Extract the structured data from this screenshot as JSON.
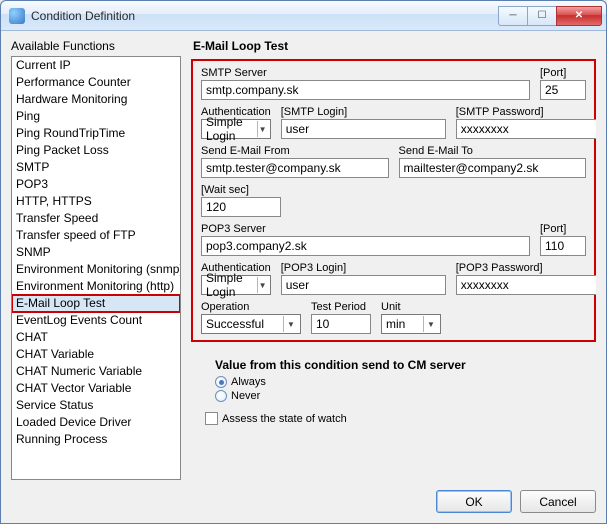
{
  "window": {
    "title": "Condition Definition"
  },
  "left": {
    "label": "Available Functions",
    "items": [
      "Current IP",
      "Performance Counter",
      "Hardware Monitoring",
      "Ping",
      "Ping RoundTripTime",
      "Ping Packet Loss",
      "SMTP",
      "POP3",
      "HTTP, HTTPS",
      "Transfer Speed",
      "Transfer speed of FTP",
      "SNMP",
      "Environment Monitoring (snmp)",
      "Environment Monitoring (http)",
      "E-Mail Loop Test",
      "EventLog Events Count",
      "CHAT",
      "CHAT Variable",
      "CHAT Numeric Variable",
      "CHAT Vector Variable",
      "Service Status",
      "Loaded Device Driver",
      "Running Process"
    ],
    "selected_index": 14,
    "redbox_index": 14
  },
  "form": {
    "title": "E-Mail Loop Test",
    "smtp_server": {
      "label": "SMTP Server",
      "value": "smtp.company.sk"
    },
    "smtp_port": {
      "label": "[Port]",
      "value": "25"
    },
    "smtp_auth": {
      "label": "Authentication",
      "value": "Simple Login"
    },
    "smtp_login": {
      "label": "[SMTP Login]",
      "value": "user"
    },
    "smtp_password": {
      "label": "[SMTP Password]",
      "value": "xxxxxxxx"
    },
    "send_from": {
      "label": "Send E-Mail From",
      "value": "smtp.tester@company.sk"
    },
    "send_to": {
      "label": "Send E-Mail To",
      "value": "mailtester@company2.sk"
    },
    "wait_sec": {
      "label": "[Wait sec]",
      "value": "120"
    },
    "pop3_server": {
      "label": "POP3 Server",
      "value": "pop3.company2.sk"
    },
    "pop3_port": {
      "label": "[Port]",
      "value": "110"
    },
    "pop3_auth": {
      "label": "Authentication",
      "value": "Simple Login"
    },
    "pop3_login": {
      "label": "[POP3 Login]",
      "value": "user"
    },
    "pop3_password": {
      "label": "[POP3 Password]",
      "value": "xxxxxxxx"
    },
    "operation": {
      "label": "Operation",
      "value": "Successful"
    },
    "test_period": {
      "label": "Test Period",
      "value": "10"
    },
    "unit": {
      "label": "Unit",
      "value": "min"
    }
  },
  "value_send": {
    "title": "Value from this condition send to CM server",
    "always": "Always",
    "never": "Never",
    "selected": "always"
  },
  "assess": {
    "label": "Assess the state of watch",
    "checked": false
  },
  "buttons": {
    "ok": "OK",
    "cancel": "Cancel"
  }
}
